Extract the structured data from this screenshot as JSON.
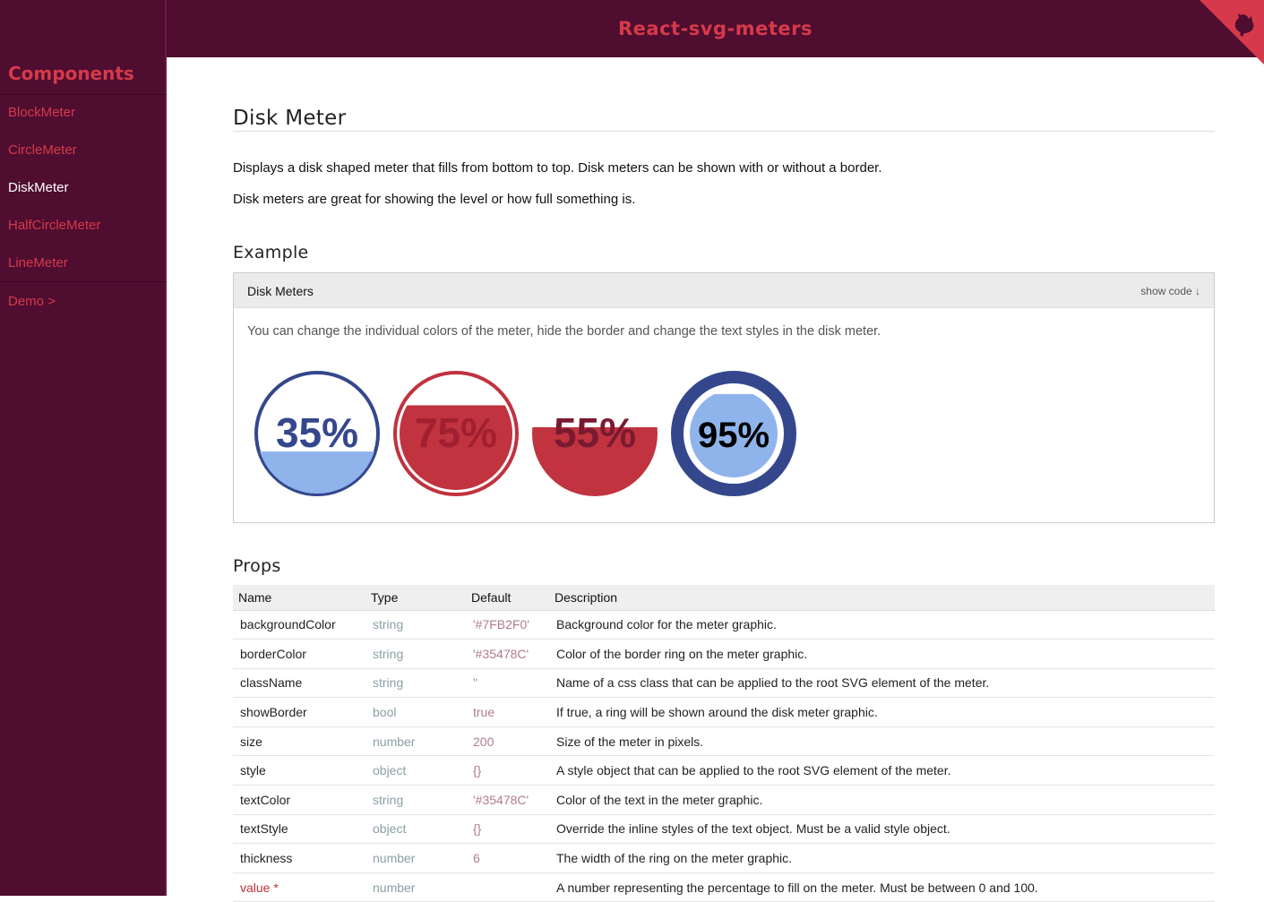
{
  "app": {
    "title": "React-svg-meters"
  },
  "sidebar": {
    "header": "Components",
    "items": [
      {
        "label": "BlockMeter",
        "active": false
      },
      {
        "label": "CircleMeter",
        "active": false
      },
      {
        "label": "DiskMeter",
        "active": true
      },
      {
        "label": "HalfCircleMeter",
        "active": false
      },
      {
        "label": "LineMeter",
        "active": false
      }
    ],
    "demo_link": "Demo >"
  },
  "page": {
    "title": "Disk Meter",
    "description_1": "Displays a disk shaped meter that fills from bottom to top. Disk meters can be shown with or without a border.",
    "description_2": "Disk meters are great for showing the level or how full something is."
  },
  "example": {
    "heading": "Example",
    "box_title": "Disk Meters",
    "show_code": "show code ↓",
    "text": "You can change the individual colors of the meter, hide the border and change the text styles in the disk meter.",
    "meters": [
      {
        "value": 35,
        "label": "35%",
        "fill": "#8fb4ec",
        "border": "#35478c",
        "text_color": "#35478c",
        "show_border": true
      },
      {
        "value": 75,
        "label": "75%",
        "fill": "#c0333f",
        "border": "#c0333f",
        "text_color": "#a02030",
        "show_border": true
      },
      {
        "value": 55,
        "label": "55%",
        "fill": "#c0333f",
        "border": "#c0333f",
        "text_color": "#7a1a30",
        "show_border": false
      },
      {
        "value": 95,
        "label": "95%",
        "fill": "#8fb4ec",
        "border": "#35478c",
        "text_color": "#000000",
        "show_border": true
      }
    ]
  },
  "props": {
    "heading": "Props",
    "columns": [
      "Name",
      "Type",
      "Default",
      "Description"
    ],
    "rows": [
      {
        "name": "backgroundColor",
        "type": "string",
        "default": "'#7FB2F0'",
        "description": "Background color for the meter graphic.",
        "required": false
      },
      {
        "name": "borderColor",
        "type": "string",
        "default": "'#35478C'",
        "description": "Color of the border ring on the meter graphic.",
        "required": false
      },
      {
        "name": "className",
        "type": "string",
        "default": "''",
        "description": "Name of a css class that can be applied to the root SVG element of the meter.",
        "required": false
      },
      {
        "name": "showBorder",
        "type": "bool",
        "default": "true",
        "description": "If true, a ring will be shown around the disk meter graphic.",
        "required": false
      },
      {
        "name": "size",
        "type": "number",
        "default": "200",
        "description": "Size of the meter in pixels.",
        "required": false
      },
      {
        "name": "style",
        "type": "object",
        "default": "{}",
        "description": "A style object that can be applied to the root SVG element of the meter.",
        "required": false
      },
      {
        "name": "textColor",
        "type": "string",
        "default": "'#35478C'",
        "description": "Color of the text in the meter graphic.",
        "required": false
      },
      {
        "name": "textStyle",
        "type": "object",
        "default": "{}",
        "description": "Override the inline styles of the text object. Must be a valid style object.",
        "required": false
      },
      {
        "name": "thickness",
        "type": "number",
        "default": "6",
        "description": "The width of the ring on the meter graphic.",
        "required": false
      },
      {
        "name": "value *",
        "type": "number",
        "default": "",
        "description": "A number representing the percentage to fill on the meter. Must be between 0 and 100.",
        "required": true
      }
    ]
  },
  "colors": {
    "sidebar_bg": "#4f0d30",
    "accent": "#d63a4a",
    "meter_blue": "#35478c",
    "meter_light_blue": "#8fb4ec",
    "meter_red": "#c0333f"
  }
}
